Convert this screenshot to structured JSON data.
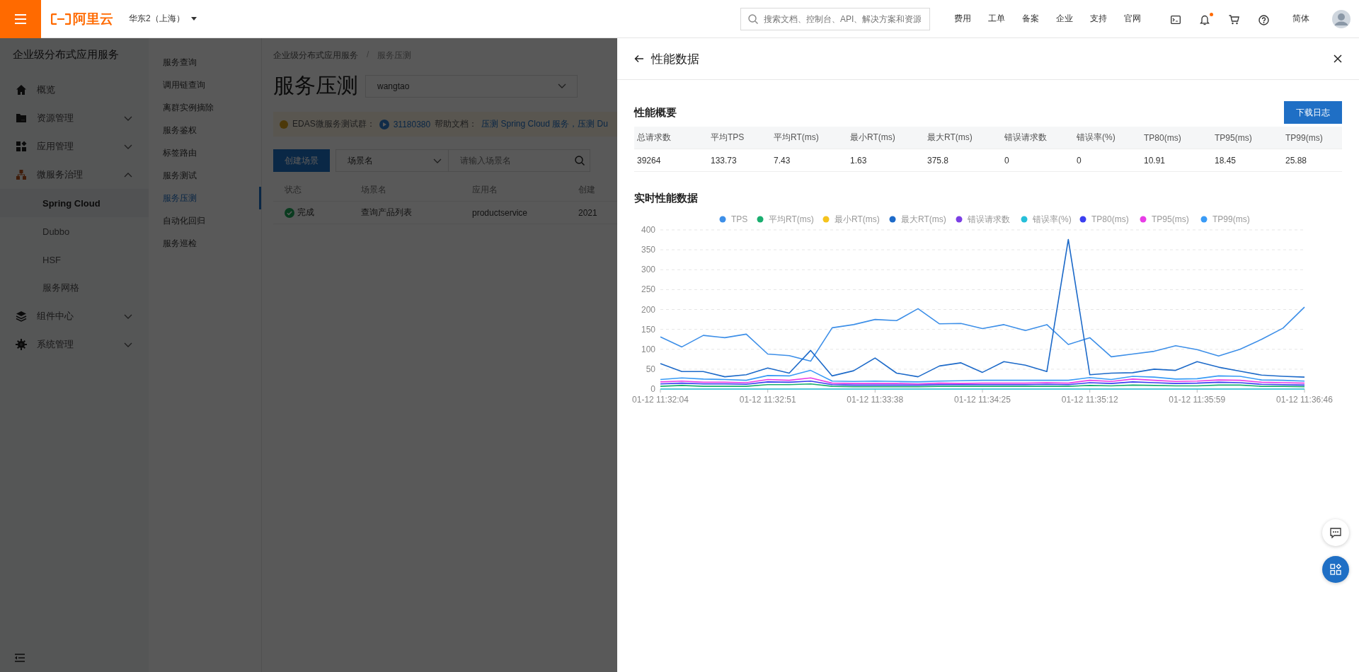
{
  "topbar": {
    "logo": "阿里云",
    "region": "华东2（上海）",
    "search": {
      "placeholder": "搜索文档、控制台、API、解决方案和资源"
    },
    "nav": [
      "费用",
      "工单",
      "备案",
      "企业",
      "支持",
      "官网"
    ],
    "has_notification": true,
    "language": "简体"
  },
  "sidebar": {
    "title": "企业级分布式应用服务",
    "items": [
      {
        "label": "概览"
      },
      {
        "label": "资源管理",
        "expanded": false
      },
      {
        "label": "应用管理",
        "expanded": false
      },
      {
        "label": "微服务治理",
        "expanded": true,
        "children": [
          {
            "label": "Spring Cloud",
            "selected": true
          },
          {
            "label": "Dubbo",
            "selected": false
          },
          {
            "label": "HSF",
            "selected": false
          },
          {
            "label": "服务网格",
            "selected": false
          }
        ]
      },
      {
        "label": "组件中心",
        "expanded": false
      },
      {
        "label": "系统管理",
        "expanded": false
      }
    ]
  },
  "submenu": [
    {
      "label": "服务查询",
      "selected": false
    },
    {
      "label": "调用链查询",
      "selected": false
    },
    {
      "label": "离群实例摘除",
      "selected": false
    },
    {
      "label": "服务鉴权",
      "selected": false
    },
    {
      "label": "标签路由",
      "selected": false
    },
    {
      "label": "服务测试",
      "selected": false
    },
    {
      "label": "服务压测",
      "selected": true
    },
    {
      "label": "自动化回归",
      "selected": false
    },
    {
      "label": "服务巡检",
      "selected": false
    }
  ],
  "main": {
    "breadcrumb": [
      "企业级分布式应用服务",
      "服务压测"
    ],
    "breadcrumb_separator": "/",
    "title": "服务压测",
    "namespace": "wangtao",
    "notice": {
      "group_label": "EDAS微服务测试群：",
      "group_id": "31180380",
      "help_label": "帮助文档：",
      "links": [
        "压测 Spring Cloud 服务",
        "压测 Du"
      ],
      "link_separator": "，"
    },
    "create_button": "创建场景",
    "filter": "场景名",
    "search": {
      "placeholder": "请输入场景名"
    },
    "table": {
      "columns": [
        "状态",
        "场景名",
        "应用名",
        "创建"
      ],
      "rows": [
        {
          "kind": "success",
          "cells": [
            "完成",
            "查询产品列表",
            "productservice",
            "2021"
          ]
        }
      ]
    }
  },
  "drawer": {
    "title": "性能数据",
    "summary_title": "性能概要",
    "download_button": "下载日志",
    "summary": {
      "columns": [
        "总请求数",
        "平均TPS",
        "平均RT(ms)",
        "最小RT(ms)",
        "最大RT(ms)",
        "错误请求数",
        "错误率(%)",
        "TP80(ms)",
        "TP95(ms)",
        "TP99(ms)"
      ],
      "rows": [
        [
          "39264",
          "133.73",
          "7.43",
          "1.63",
          "375.8",
          "0",
          "0",
          "10.91",
          "18.45",
          "25.88"
        ]
      ]
    },
    "realtime_title": "实时性能数据",
    "chart_data": {
      "type": "line",
      "categories": [
        "01-12 11:32:04",
        null,
        null,
        null,
        null,
        "01-12 11:32:51",
        null,
        null,
        null,
        null,
        "01-12 11:33:38",
        null,
        null,
        null,
        null,
        "01-12 11:34:25",
        null,
        null,
        null,
        null,
        "01-12 11:35:12",
        null,
        null,
        null,
        null,
        "01-12 11:35:59",
        null,
        null,
        null,
        null,
        "01-12 11:36:46"
      ],
      "ylim": [
        0,
        400
      ],
      "grid": true,
      "legend": true,
      "yticks": [
        0,
        50,
        100,
        150,
        200,
        250,
        300,
        350,
        400
      ],
      "series": [
        {
          "name": "TPS",
          "color": "#3d8fe8",
          "values": [
            131,
            106,
            135,
            129,
            138,
            88,
            84,
            70,
            154,
            162,
            175,
            172,
            202,
            164,
            165,
            152,
            162,
            147,
            162,
            112,
            129,
            81,
            88,
            95,
            109,
            99,
            83,
            100,
            125,
            153,
            206
          ]
        },
        {
          "name": "平均RT(ms)",
          "color": "#1aae6f",
          "values": [
            7,
            9,
            7,
            7,
            7,
            11,
            11,
            13,
            7,
            6,
            6,
            6,
            6,
            7,
            7,
            7,
            7,
            7,
            7,
            7,
            9,
            8,
            10,
            9,
            8,
            8,
            10,
            10,
            7,
            7,
            6
          ]
        },
        {
          "name": "最小RT(ms)",
          "color": "#f5c31d",
          "values": [
            null,
            null,
            null,
            null,
            null,
            null,
            null,
            null,
            null,
            null,
            null,
            null,
            null,
            null,
            null,
            null,
            null,
            null,
            null,
            null,
            null,
            null,
            null,
            null,
            null,
            null,
            null,
            null,
            null,
            null,
            null
          ]
        },
        {
          "name": "最大RT(ms)",
          "color": "#1d6ac9",
          "values": [
            64,
            44,
            44,
            31,
            36,
            53,
            40,
            97,
            33,
            46,
            78,
            40,
            31,
            58,
            66,
            42,
            69,
            60,
            44,
            376,
            36,
            40,
            41,
            50,
            47,
            69,
            55,
            45,
            35,
            32,
            30
          ]
        },
        {
          "name": "错误请求数",
          "color": "#7b3fe4",
          "values": [
            null,
            null,
            null,
            null,
            null,
            null,
            null,
            null,
            null,
            null,
            null,
            null,
            null,
            null,
            null,
            null,
            null,
            null,
            null,
            null,
            null,
            null,
            null,
            null,
            null,
            null,
            null,
            null,
            null,
            null,
            null
          ]
        },
        {
          "name": "错误率(%)",
          "color": "#26bfd9",
          "values": [
            0,
            0,
            0,
            0,
            0,
            0,
            0,
            0,
            0,
            0,
            0,
            0,
            0,
            0,
            0,
            0,
            0,
            0,
            0,
            0,
            0,
            0,
            0,
            0,
            0,
            0,
            0,
            0,
            0,
            0,
            0
          ]
        },
        {
          "name": "TP80(ms)",
          "color": "#3b3ff0",
          "values": [
            13,
            15,
            13,
            13,
            12,
            18,
            17,
            20,
            11,
            10,
            10,
            10,
            10,
            11,
            11,
            11,
            11,
            11,
            12,
            11,
            16,
            14,
            18,
            16,
            14,
            15,
            17,
            16,
            12,
            11,
            10
          ]
        },
        {
          "name": "TP95(ms)",
          "color": "#e83de6",
          "values": [
            18,
            20,
            17,
            17,
            16,
            24,
            22,
            28,
            15,
            14,
            14,
            14,
            13,
            15,
            14,
            15,
            15,
            15,
            16,
            15,
            22,
            19,
            25,
            22,
            19,
            20,
            23,
            22,
            17,
            16,
            15
          ]
        },
        {
          "name": "TP99(ms)",
          "color": "#3a9bf6",
          "values": [
            24,
            28,
            25,
            24,
            22,
            34,
            33,
            47,
            20,
            19,
            20,
            19,
            18,
            20,
            21,
            22,
            22,
            22,
            22,
            22,
            29,
            24,
            32,
            30,
            25,
            26,
            33,
            32,
            23,
            22,
            20
          ]
        }
      ]
    }
  }
}
